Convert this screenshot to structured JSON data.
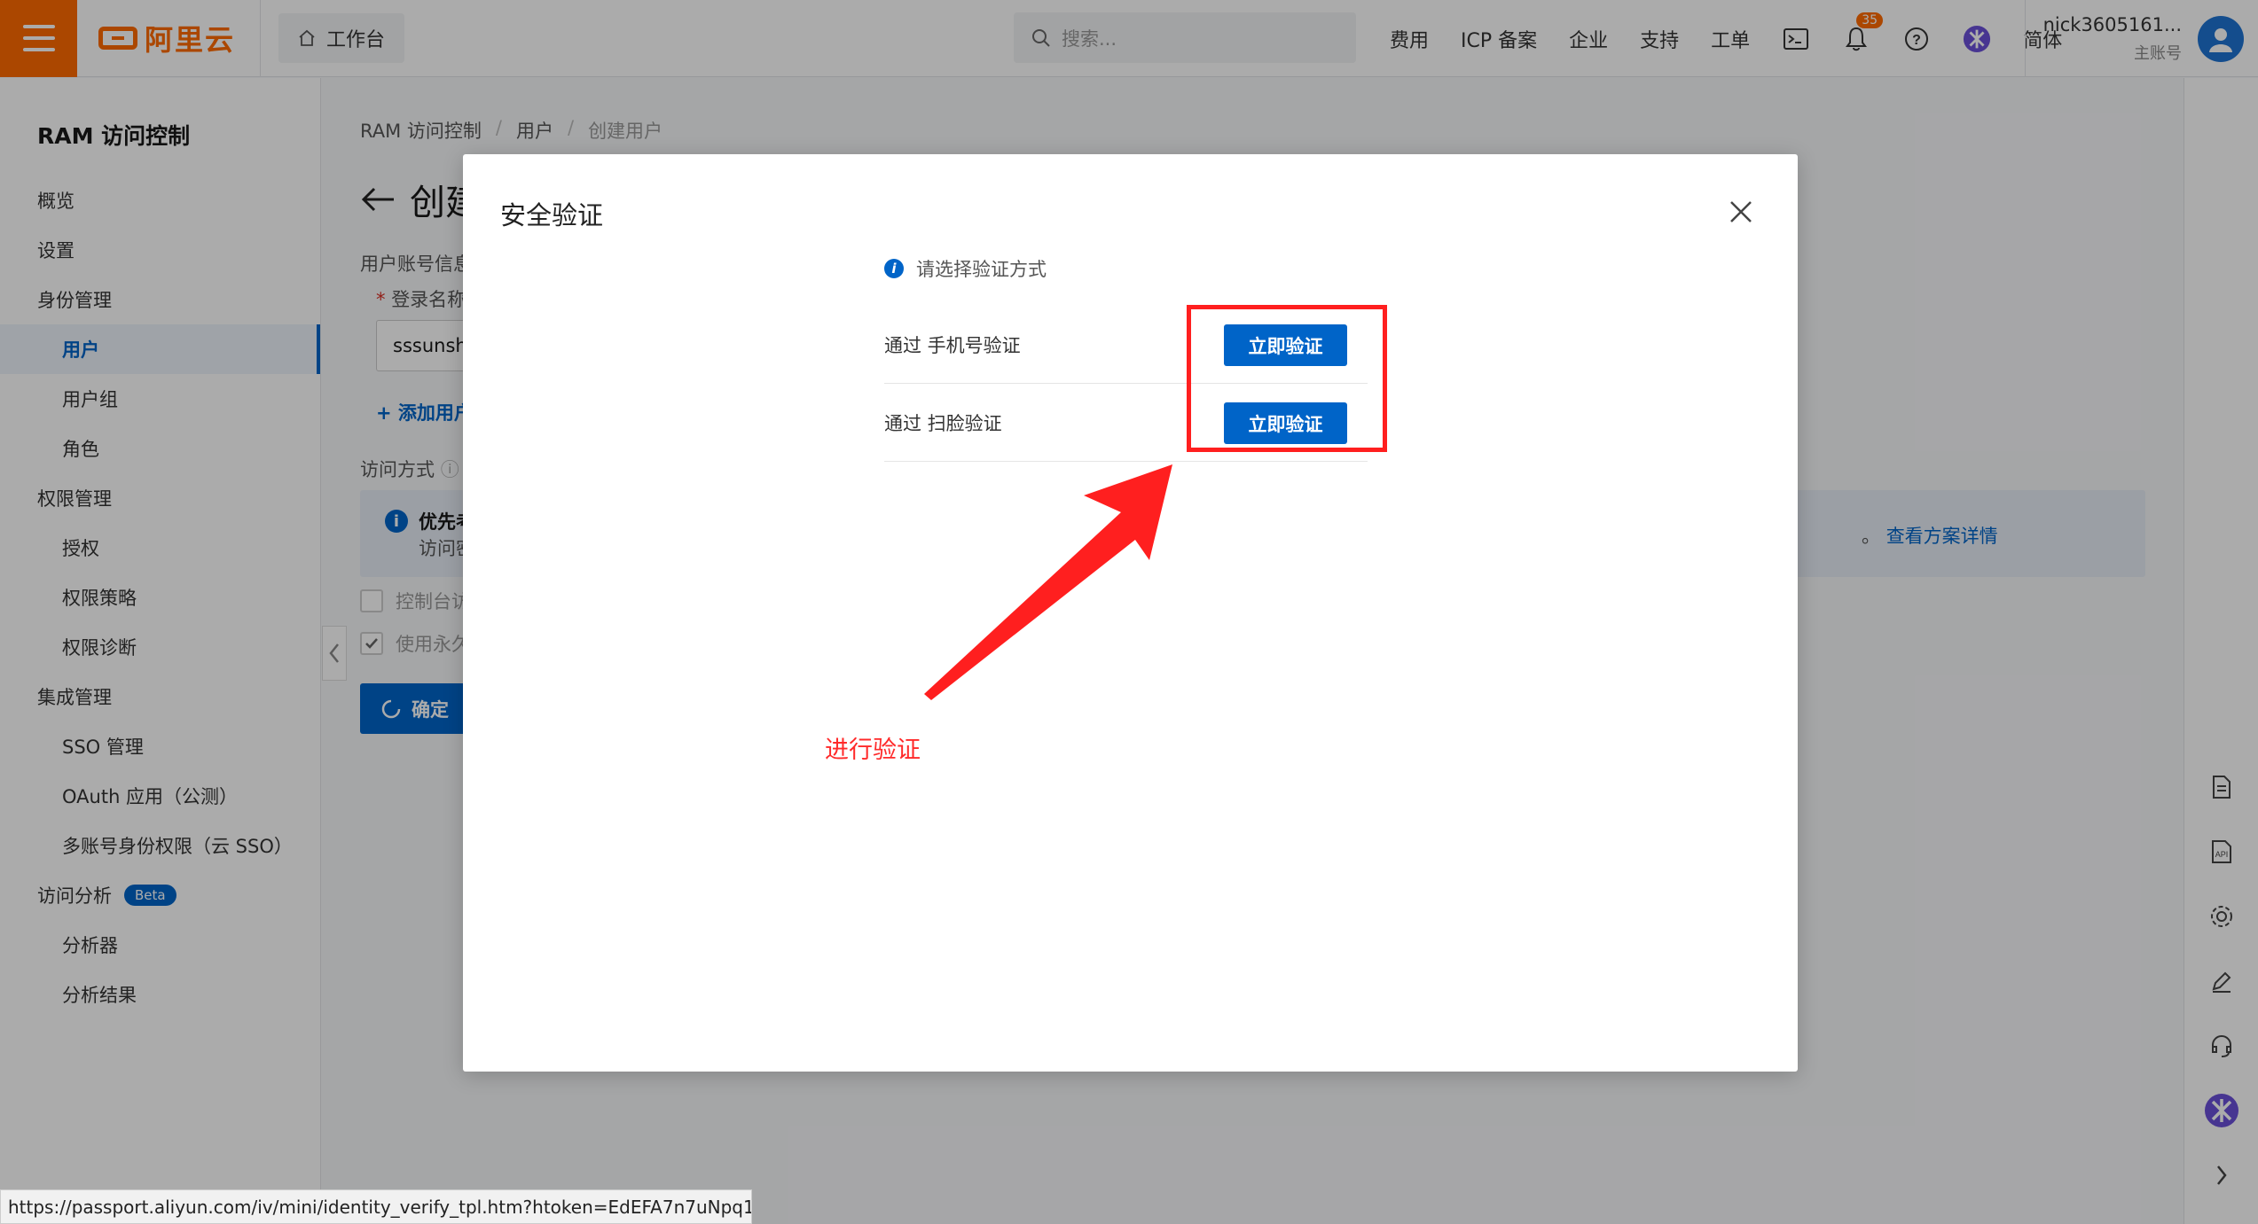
{
  "topbar": {
    "brand": "阿里云",
    "workbench": "工作台",
    "search_placeholder": "搜索...",
    "nav": [
      "费用",
      "ICP 备案",
      "企业",
      "支持",
      "工单"
    ],
    "notification_count": "35",
    "language": "简体",
    "account_name": "nick3605161...",
    "account_type": "主账号",
    "accent": "#ff6a00"
  },
  "sidebar": {
    "title": "RAM 访问控制",
    "items": [
      {
        "label": "概览"
      },
      {
        "label": "设置"
      },
      {
        "label": "身份管理"
      },
      {
        "label": "用户"
      },
      {
        "label": "用户组"
      },
      {
        "label": "角色"
      },
      {
        "label": "权限管理"
      },
      {
        "label": "授权"
      },
      {
        "label": "权限策略"
      },
      {
        "label": "权限诊断"
      },
      {
        "label": "集成管理"
      },
      {
        "label": "SSO 管理"
      },
      {
        "label": "OAuth 应用（公测）"
      },
      {
        "label": "多账号身份权限（云 SSO）"
      },
      {
        "label": "访问分析"
      },
      {
        "label": "分析器"
      },
      {
        "label": "分析结果"
      }
    ],
    "beta_badge": "Beta"
  },
  "main": {
    "breadcrumb": [
      "RAM 访问控制",
      "用户",
      "创建用户"
    ],
    "title_partial": "创建",
    "section_label": "用户账号信息",
    "login_name_label": "登录名称",
    "login_name_value": "sssunshi",
    "add_user_link": "添加用户",
    "access_mode_label": "访问方式",
    "info_title": "优先考",
    "info_text": "访问密",
    "info_link_prefix": "。",
    "info_link": "查看方案详情",
    "checkbox1": "控制台访",
    "checkbox2": "使用永久",
    "confirm": "确定"
  },
  "modal": {
    "title": "安全验证",
    "hint": "请选择验证方式",
    "options": [
      {
        "label": "通过 手机号验证",
        "button": "立即验证"
      },
      {
        "label": "通过 扫脸验证",
        "button": "立即验证"
      }
    ],
    "annotation": "进行验证",
    "annotation_color": "#ff2a2a"
  },
  "status_url": "https://passport.aliyun.com/iv/mini/identity_verify_tpl.htm?htoken=EdEFA7n7uNpq1UD..."
}
